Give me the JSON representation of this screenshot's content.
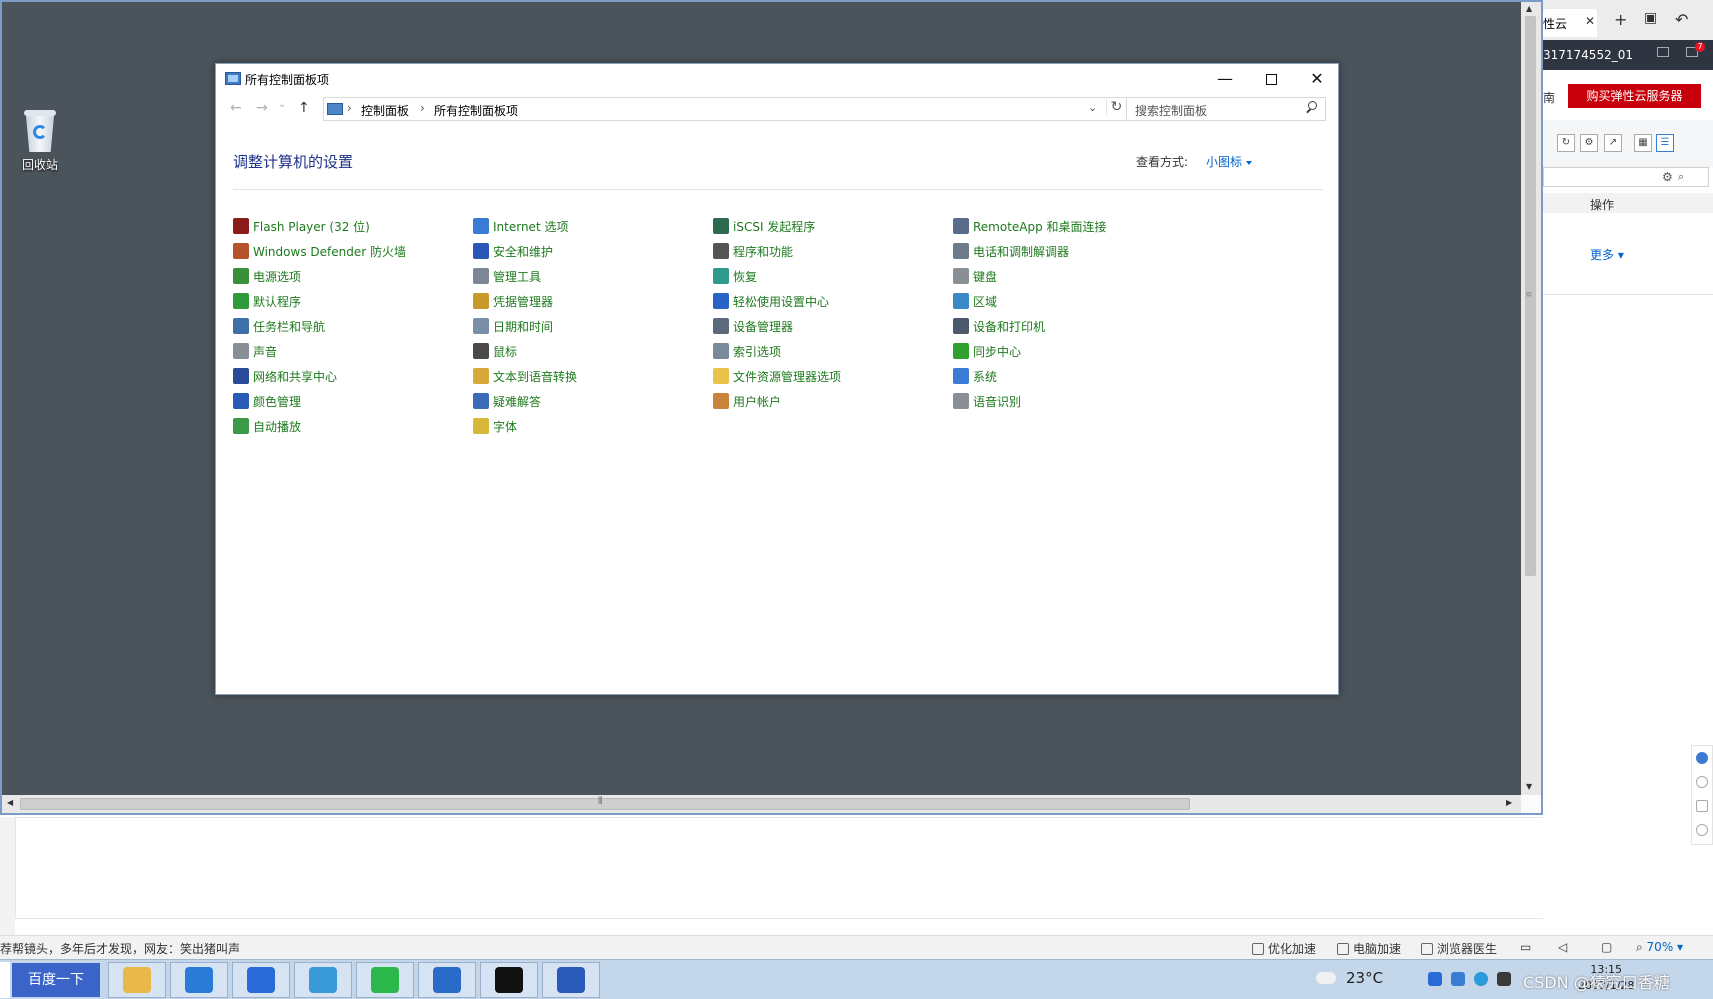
{
  "desktop": {
    "recycle_bin_label": "回收站"
  },
  "window": {
    "title": "所有控制面板项",
    "minimize_glyph": "—",
    "close_glyph": "✕"
  },
  "navigation": {
    "back_glyph": "←",
    "forward_glyph": "→",
    "recent_glyph": "⌄",
    "up_glyph": "↑",
    "breadcrumb": [
      "控制面板",
      "所有控制面板项"
    ],
    "separator": "›",
    "dropdown_glyph": "⌄",
    "refresh_glyph": "↻",
    "search_placeholder": "搜索控制面板"
  },
  "content": {
    "heading": "调整计算机的设置",
    "view_by_label": "查看方式:",
    "view_by_value": "小图标"
  },
  "items": [
    {
      "label": "Flash Player (32 位)",
      "icon": "flash-icon",
      "color": "#8b1a1a"
    },
    {
      "label": "Internet 选项",
      "icon": "internet-options-icon",
      "color": "#3a7bd5"
    },
    {
      "label": "iSCSI 发起程序",
      "icon": "iscsi-icon",
      "color": "#2d6a4f"
    },
    {
      "label": "RemoteApp 和桌面连接",
      "icon": "remoteapp-icon",
      "color": "#5b6b8a"
    },
    {
      "label": "Windows Defender 防火墙",
      "icon": "firewall-icon",
      "color": "#b5532b"
    },
    {
      "label": "安全和维护",
      "icon": "flag-icon",
      "color": "#2a56b8"
    },
    {
      "label": "程序和功能",
      "icon": "programs-icon",
      "color": "#555555"
    },
    {
      "label": "电话和调制解调器",
      "icon": "phone-modem-icon",
      "color": "#6c7a89"
    },
    {
      "label": "电源选项",
      "icon": "power-icon",
      "color": "#3a8f3a"
    },
    {
      "label": "管理工具",
      "icon": "admin-tools-icon",
      "color": "#7d8794"
    },
    {
      "label": "恢复",
      "icon": "recovery-icon",
      "color": "#2e9a8a"
    },
    {
      "label": "键盘",
      "icon": "keyboard-icon",
      "color": "#8a8f96"
    },
    {
      "label": "默认程序",
      "icon": "default-programs-icon",
      "color": "#2e9a3a"
    },
    {
      "label": "凭据管理器",
      "icon": "credential-icon",
      "color": "#c79a2a"
    },
    {
      "label": "轻松使用设置中心",
      "icon": "ease-of-access-icon",
      "color": "#2a63c8"
    },
    {
      "label": "区域",
      "icon": "region-icon",
      "color": "#3a8ac8"
    },
    {
      "label": "任务栏和导航",
      "icon": "taskbar-icon",
      "color": "#3f6fa8"
    },
    {
      "label": "日期和时间",
      "icon": "clock-icon",
      "color": "#7a8ea8"
    },
    {
      "label": "设备管理器",
      "icon": "device-manager-icon",
      "color": "#5a6a7a"
    },
    {
      "label": "设备和打印机",
      "icon": "printer-icon",
      "color": "#4a5a6a"
    },
    {
      "label": "声音",
      "icon": "speaker-icon",
      "color": "#8a8f96"
    },
    {
      "label": "鼠标",
      "icon": "mouse-icon",
      "color": "#4a4a4a"
    },
    {
      "label": "索引选项",
      "icon": "indexing-icon",
      "color": "#7a8a9a"
    },
    {
      "label": "同步中心",
      "icon": "sync-icon",
      "color": "#2ea02e"
    },
    {
      "label": "网络和共享中心",
      "icon": "network-icon",
      "color": "#2a4a9a"
    },
    {
      "label": "文本到语音转换",
      "icon": "text-to-speech-icon",
      "color": "#d8a83a"
    },
    {
      "label": "文件资源管理器选项",
      "icon": "folder-options-icon",
      "color": "#e8c24a"
    },
    {
      "label": "系统",
      "icon": "system-icon",
      "color": "#3a7bd5"
    },
    {
      "label": "颜色管理",
      "icon": "color-management-icon",
      "color": "#2a5ab8"
    },
    {
      "label": "疑难解答",
      "icon": "troubleshoot-icon",
      "color": "#3a6ab8"
    },
    {
      "label": "用户帐户",
      "icon": "user-accounts-icon",
      "color": "#c8843a"
    },
    {
      "label": "语音识别",
      "icon": "microphone-icon",
      "color": "#8a8f96"
    },
    {
      "label": "自动播放",
      "icon": "autoplay-icon",
      "color": "#3a9a4a"
    },
    {
      "label": "字体",
      "icon": "fonts-icon",
      "color": "#d8b83a"
    }
  ],
  "right_panel": {
    "tab_label": "性云",
    "tab_close": "✕",
    "new_tab": "+",
    "back_icon": "↶",
    "instance_id": "317174552_01",
    "notification_count": "7",
    "nan_text": "南",
    "buy_button": "购买弹性云服务器",
    "column_header": "操作",
    "more_link": "更多"
  },
  "status_bar": {
    "news": "荐帮镜头，多年后才发现，网友：笑出猪叫声",
    "items": [
      "优化加速",
      "电脑加速",
      "浏览器医生"
    ],
    "zoom": "70%"
  },
  "taskbar": {
    "baidu_button": "百度一下",
    "apps": [
      {
        "name": "file-explorer-icon",
        "color": "#e8b84a"
      },
      {
        "name": "ie-browser-icon",
        "color": "#2a7ad8"
      },
      {
        "name": "window-manager-icon",
        "color": "#2a6ad8"
      },
      {
        "name": "qq-icon",
        "color": "#3a9ad8"
      },
      {
        "name": "wechat-icon",
        "color": "#2ab84a"
      },
      {
        "name": "wang-icon",
        "color": "#2a6ac8"
      },
      {
        "name": "terminal-icon",
        "color": "#111111"
      },
      {
        "name": "remote-desktop-icon",
        "color": "#2a5ab8"
      }
    ],
    "temperature": "23°C",
    "clock_time": "13:15",
    "clock_date": "2022/1/28",
    "watermark": "CSDN @猿究口香糖"
  }
}
